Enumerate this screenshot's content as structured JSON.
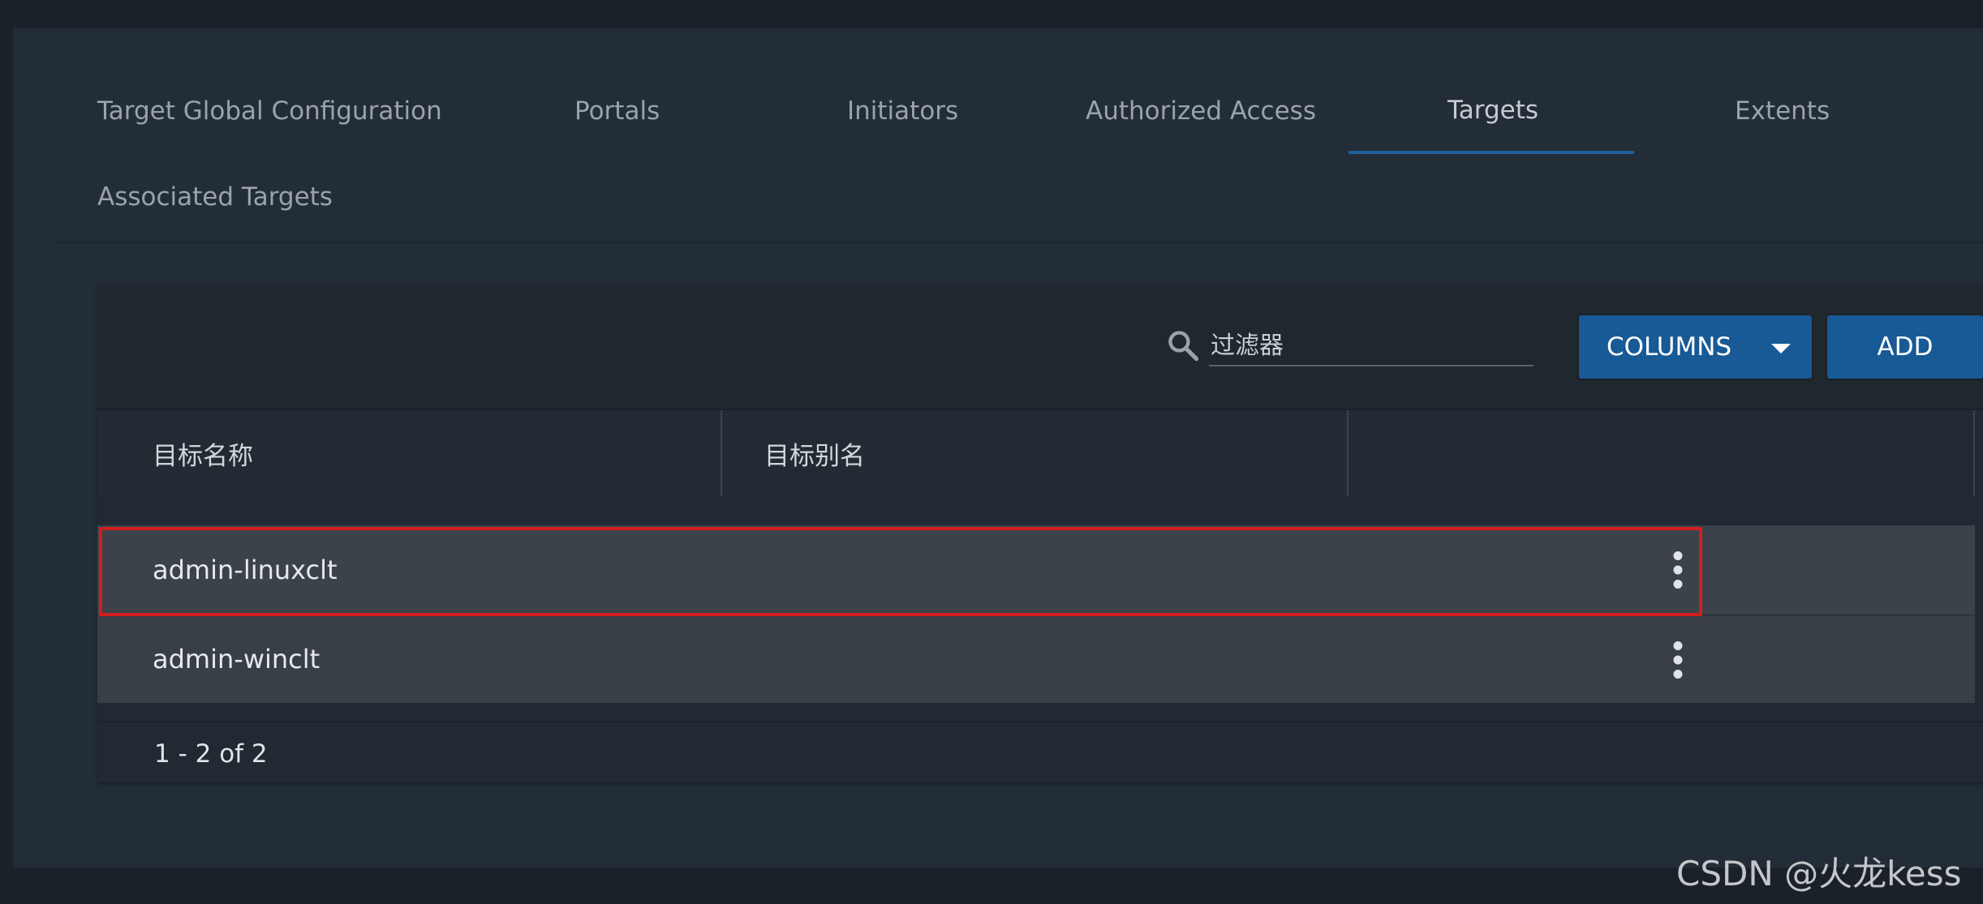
{
  "tabs": [
    {
      "label": "Target Global Configuration"
    },
    {
      "label": "Portals"
    },
    {
      "label": "Initiators"
    },
    {
      "label": "Authorized Access"
    },
    {
      "label": "Targets",
      "active": true
    },
    {
      "label": "Extents"
    },
    {
      "label": "Associated Targets"
    }
  ],
  "toolbar": {
    "filter_placeholder": "过滤器",
    "columns_label": "COLUMNS",
    "add_label": "ADD"
  },
  "table": {
    "columns": [
      "目标名称",
      "目标别名",
      ""
    ],
    "rows": [
      {
        "name": "admin-linuxclt",
        "alias": "",
        "highlighted": true
      },
      {
        "name": "admin-winclt",
        "alias": "",
        "highlighted": false
      }
    ]
  },
  "pager": {
    "text": "1 - 2 of 2"
  },
  "watermark": "CSDN @火龙kess",
  "colors": {
    "accent": "#175a96",
    "highlight": "#d31d1d",
    "background": "#232d37"
  },
  "icons": {
    "search": "search-icon",
    "dropdown": "caret-down-icon",
    "row_menu": "more-vert-icon"
  }
}
